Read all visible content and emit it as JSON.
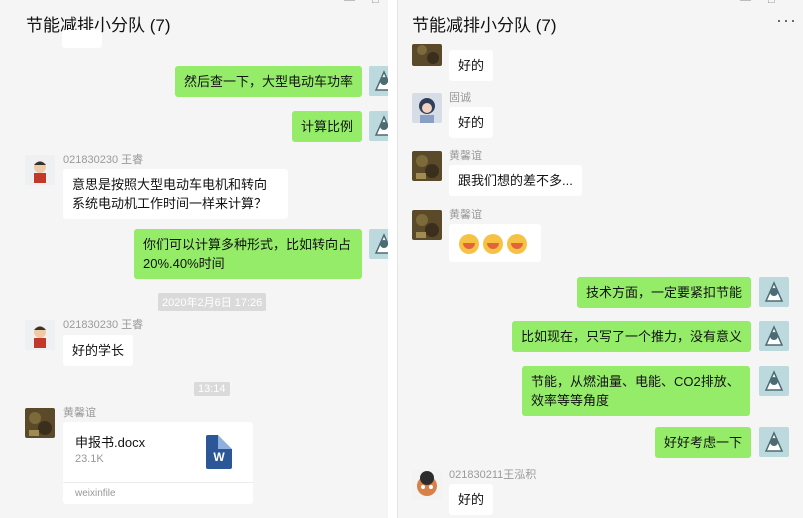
{
  "left_chat": {
    "title": "节能减排小分队 (7)",
    "messages": [
      {
        "text": "然后查一下，大型电动车功率"
      },
      {
        "text": "计算比例"
      },
      {
        "sender": "021830230 王睿",
        "text": "意思是按照大型电动车电机和转向系统电动机工作时间一样来计算？"
      },
      {
        "text": "你们可以计算多种形式，比如转向占20%.40%时间"
      },
      {
        "timestamp": "2020年2月6日 17:26"
      },
      {
        "sender": "021830230 王睿",
        "text": "好的学长"
      },
      {
        "timestamp": "13:14"
      },
      {
        "sender": "黄馨谊",
        "file": {
          "name": "申报书.docx",
          "size": "23.1K",
          "source": "weixinfile",
          "icon": "word-icon"
        }
      }
    ]
  },
  "right_chat": {
    "title": "节能减排小分队 (7)",
    "more_icon": "···",
    "messages": [
      {
        "text": "好的"
      },
      {
        "sender": "固诚",
        "text": "好的"
      },
      {
        "sender": "黄馨谊",
        "text": "跟我们想的差不多..."
      },
      {
        "sender": "黄馨谊",
        "emoji": [
          "laugh-cry-emoji",
          "laugh-cry-emoji",
          "laugh-cry-emoji"
        ]
      },
      {
        "text": "技术方面，一定要紧扣节能"
      },
      {
        "text": "比如现在，只写了一个推力，没有意义"
      },
      {
        "text": "节能，从燃油量、电能、CO2排放、效率等等角度"
      },
      {
        "text": "好好考虑一下"
      },
      {
        "sender": "021830211王泓积",
        "text": "好的"
      }
    ]
  },
  "colors": {
    "self_bubble": "#95ec69",
    "other_bubble": "#ffffff",
    "background": "#f5f5f5"
  }
}
